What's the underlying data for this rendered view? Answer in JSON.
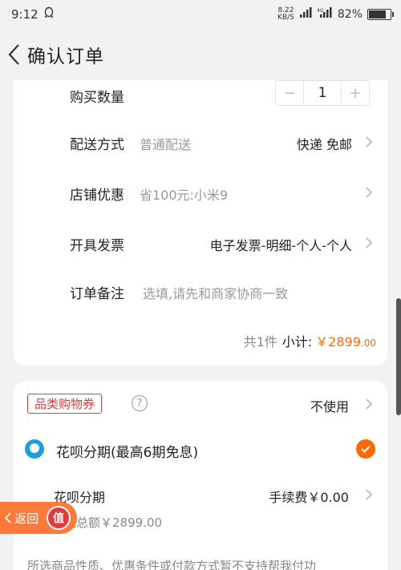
{
  "status_bar": {
    "time": "9:12",
    "speed_top": "8.22",
    "speed_bottom": "KB/S",
    "battery": "82%",
    "battery_level": 0.82
  },
  "header": {
    "title": "确认订单"
  },
  "order": {
    "quantity_label": "购买数量",
    "quantity_minus": "−",
    "quantity_value": "1",
    "quantity_plus": "+",
    "shipping_label": "配送方式",
    "shipping_value": "普通配送",
    "shipping_right": "快递 免邮",
    "discount_label": "店铺优惠",
    "discount_value": "省100元:小米9",
    "invoice_label": "开具发票",
    "invoice_right": "电子发票-明细-个人-个人",
    "note_label": "订单备注",
    "note_placeholder": "选填,请先和商家协商一致",
    "subtotal_count": "共1件",
    "subtotal_label": "小计:",
    "subtotal_price": "￥2899",
    "subtotal_decimal": ".00"
  },
  "payment": {
    "coupon_tag": "品类购物券",
    "help_icon": "?",
    "coupon_right": "不使用",
    "huabei_title": "花呗分期(最高6期免息)",
    "huabei_label": "花呗分期",
    "fee": "手续费￥0.00",
    "total": "期总额￥2899.00"
  },
  "floating": {
    "back_label": "返回",
    "badge": "值"
  },
  "bottom_note": "所选商品性质、优惠条件或付款方式暂不支持帮我付功",
  "colors": {
    "accent": "#ff6700",
    "coupon_red": "#e4393c",
    "huabei_blue": "#1a9fe0"
  }
}
